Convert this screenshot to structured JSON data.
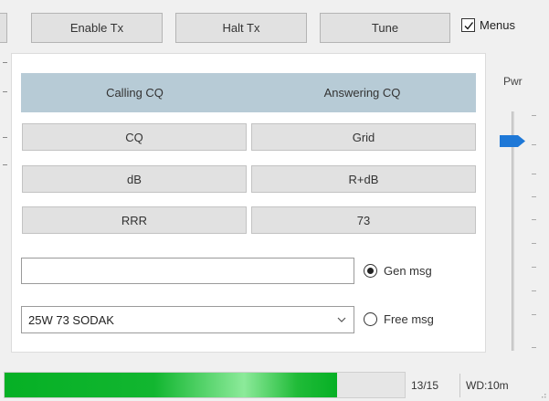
{
  "toolbar": {
    "enable_tx_label": "Enable Tx",
    "halt_tx_label": "Halt Tx",
    "tune_label": "Tune",
    "menus_label": "Menus",
    "menus_checked": true
  },
  "panel": {
    "header": {
      "calling": "Calling CQ",
      "answering": "Answering CQ",
      "color": "#b7cbd6"
    },
    "buttons": {
      "cq": "CQ",
      "grid": "Grid",
      "db": "dB",
      "rdb": "R+dB",
      "rrr": "RRR",
      "s73": "73"
    },
    "gen_msg": {
      "value": "",
      "label": "Gen msg",
      "selected": true
    },
    "free_msg": {
      "value": "25W 73 SODAK",
      "label": "Free msg",
      "selected": false
    }
  },
  "power": {
    "label": "Pwr",
    "thumb_color": "#1e78d7"
  },
  "status": {
    "progress": {
      "value": 13,
      "max": 15,
      "color": "#06b025"
    },
    "progress_text": "13/15",
    "wd_text": "WD:10m"
  }
}
